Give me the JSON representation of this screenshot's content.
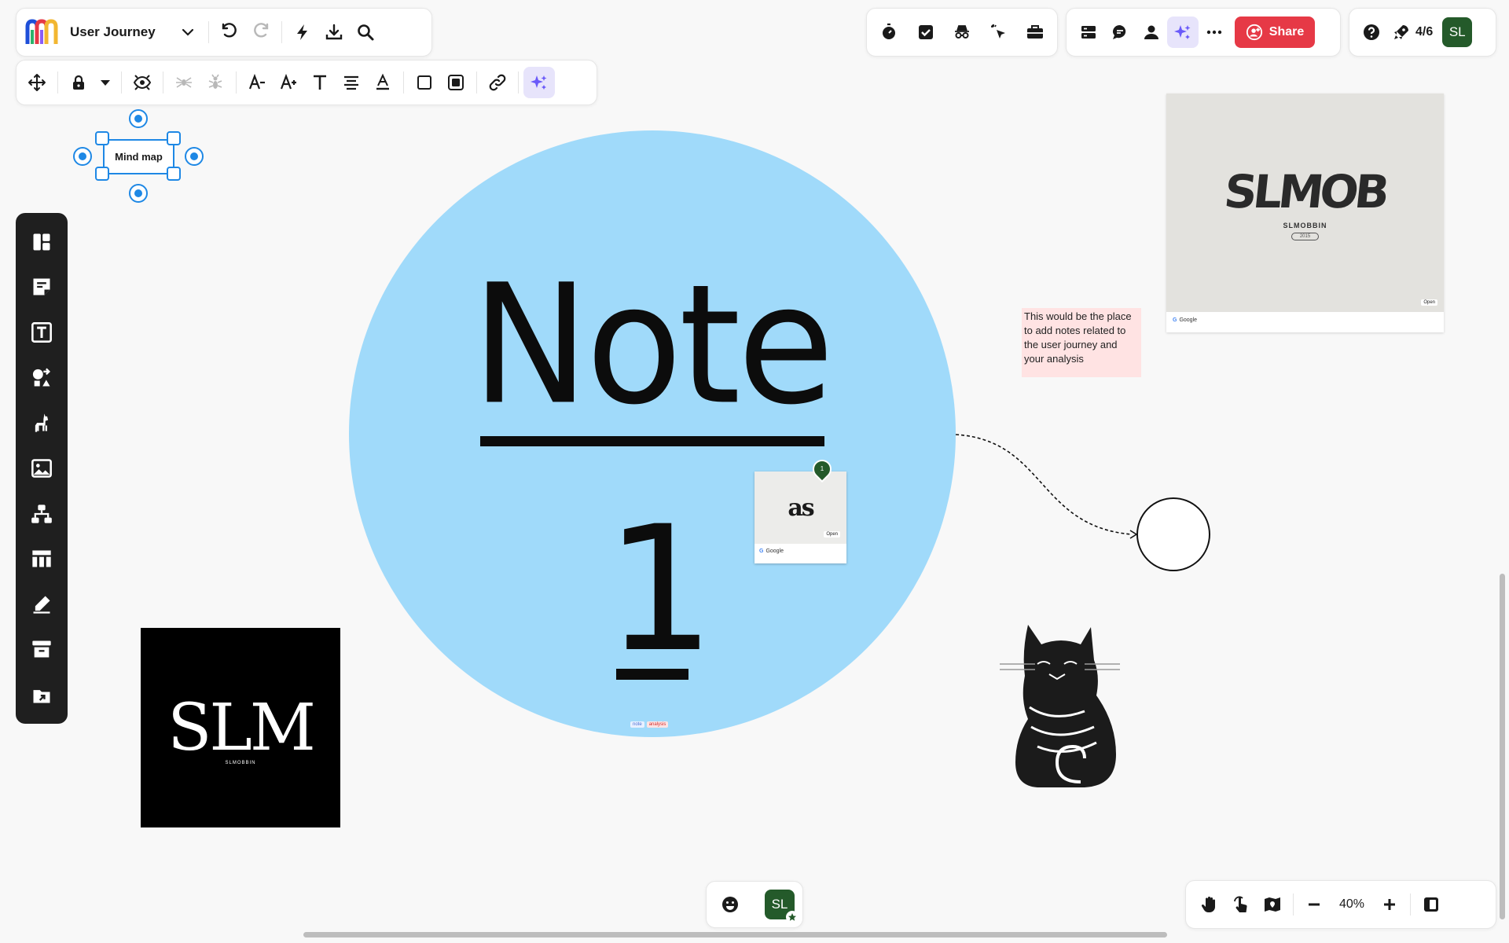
{
  "board": {
    "title": "User Journey"
  },
  "share": {
    "label": "Share"
  },
  "present": {
    "counter": "4/6"
  },
  "user": {
    "initials": "SL"
  },
  "zoom": {
    "level": "40%"
  },
  "canvas": {
    "mind_map_label": "Mind map",
    "note_title": "Note",
    "note_number": "1",
    "sticky_text": "This would be the place to add notes related to the user journey and your analysis",
    "link_card_small": {
      "logo": "as",
      "open": "Open",
      "source": "Google"
    },
    "link_card_large": {
      "logo": "SLMOB",
      "subtitle": "SLMOBBIN",
      "year": "2015",
      "open": "Open",
      "source": "Google"
    },
    "slm_image": {
      "logo": "SLM",
      "subtitle": "SLMOBBIN"
    },
    "comment_count": "1",
    "tags": [
      "note",
      "analysis"
    ]
  },
  "colors": {
    "accent": "#6a5af9",
    "share": "#e63946",
    "avatar": "#245a2a",
    "note_circle": "#a0dafa",
    "sticky": "#ffe3e3",
    "selection": "#1e88e5"
  }
}
